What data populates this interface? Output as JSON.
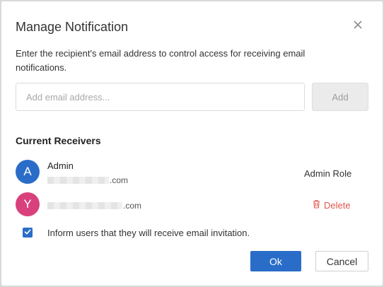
{
  "dialog": {
    "title": "Manage Notification",
    "description": "Enter the recipient's email address to control access for receiving email notifications."
  },
  "email_input": {
    "value": "",
    "placeholder": "Add email address..."
  },
  "add_button": {
    "label": "Add",
    "state": "disabled"
  },
  "receivers": {
    "title": "Current Receivers",
    "items": [
      {
        "avatar_letter": "A",
        "avatar_color": "#2a6dc8",
        "name": "Admin",
        "email_suffix": ".com",
        "action": "Admin Role"
      },
      {
        "avatar_letter": "Y",
        "avatar_color": "#d9417c",
        "name": "",
        "email_suffix": ".com",
        "action": "Delete",
        "action_icon": "trash-icon",
        "action_color": "#e0584d"
      }
    ]
  },
  "invite_option": {
    "checked": true,
    "label": "Inform users that they will receive email invitation."
  },
  "footer": {
    "ok_label": "Ok",
    "cancel_label": "Cancel"
  },
  "colors": {
    "primary": "#2a6dc8",
    "danger": "#e0584d"
  },
  "icons": {
    "close": "close-icon",
    "delete": "trash-icon",
    "checkbox": "check-icon"
  }
}
